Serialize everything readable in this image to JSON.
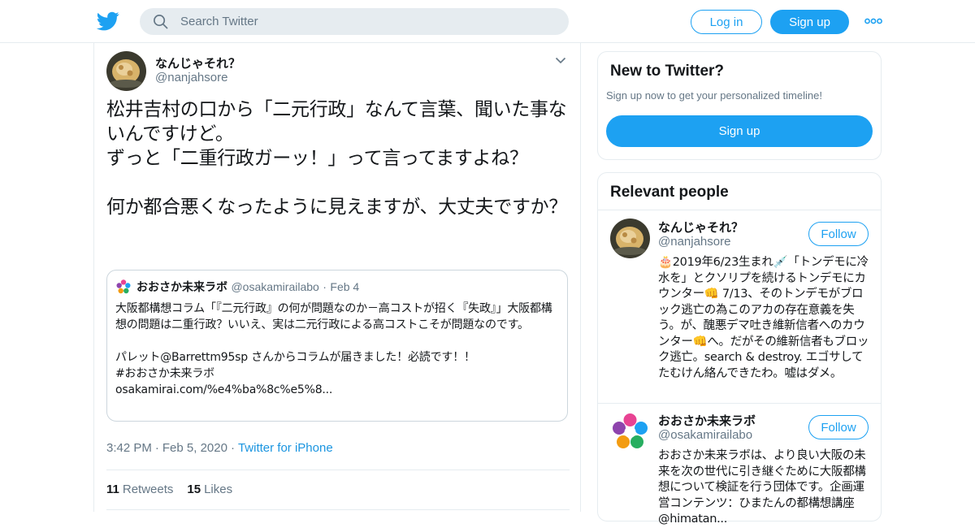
{
  "header": {
    "search_placeholder": "Search Twitter",
    "login_label": "Log in",
    "signup_label": "Sign up",
    "logo_icon": "twitter-bird-icon",
    "more_icon": "more-dots-icon",
    "brand_color": "#1da1f2"
  },
  "tweet": {
    "author_name": "なんじゃそれ？",
    "author_handle": "@nanjahsore",
    "text": "松井吉村の口から「二元行政」なんて言葉、聞いた事ないんですけど。\nずっと「二重行政ガーッ！」って言ってますよね？\n\n何か都合悪くなったように見えますが、大丈夫ですか？",
    "time": "3:42 PM",
    "date": "Feb 5, 2020",
    "source": "Twitter for iPhone",
    "retweets_count": "11",
    "retweets_label": "Retweets",
    "likes_count": "15",
    "likes_label": "Likes"
  },
  "quoted": {
    "author_name": "おおさか未来ラボ",
    "author_handle": "@osakamirailabo",
    "date": "Feb 4",
    "text": "大阪都構想コラム「『二元行政』の何が問題なのか－高コストが招く『失政』」大阪都構想の問題は二重行政？いいえ、実は二元行政による高コストこそが問題なのです。\n\nパレット@Barrettm95sp さんからコラムが届きました！必読です！！\n#おおさか未来ラボ\nosakamirai.com/%e4%ba%8c%e5%8..."
  },
  "sidebar": {
    "new_title": "New to Twitter?",
    "new_sub": "Sign up now to get your personalized timeline!",
    "new_signup_label": "Sign up",
    "relevant_title": "Relevant people",
    "people": [
      {
        "name": "なんじゃそれ？",
        "handle": "@nanjahsore",
        "follow_label": "Follow",
        "bio": "🎂2019年6/23生まれ💉「トンデモに冷水を」とクソリプを続けるトンデモにカウンター👊 7/13、そのトンデモがブロック逃亡の為このアカの存在意義を失う。が、醜悪デマ吐き維新信者へのカウンター👊へ。だがその維新信者もブロック逃亡。search & destroy. エゴサしてたむけん絡んできたわ。嘘はダメ。"
      },
      {
        "name": "おおさか未来ラボ",
        "handle": "@osakamirailabo",
        "follow_label": "Follow",
        "bio": "おおさか未来ラボは、より良い大阪の未来を次の世代に引き継ぐために大阪都構想について検証を行う団体です。企画運営コンテンツ：ひまたんの都構想講座 @himatan..."
      }
    ]
  }
}
